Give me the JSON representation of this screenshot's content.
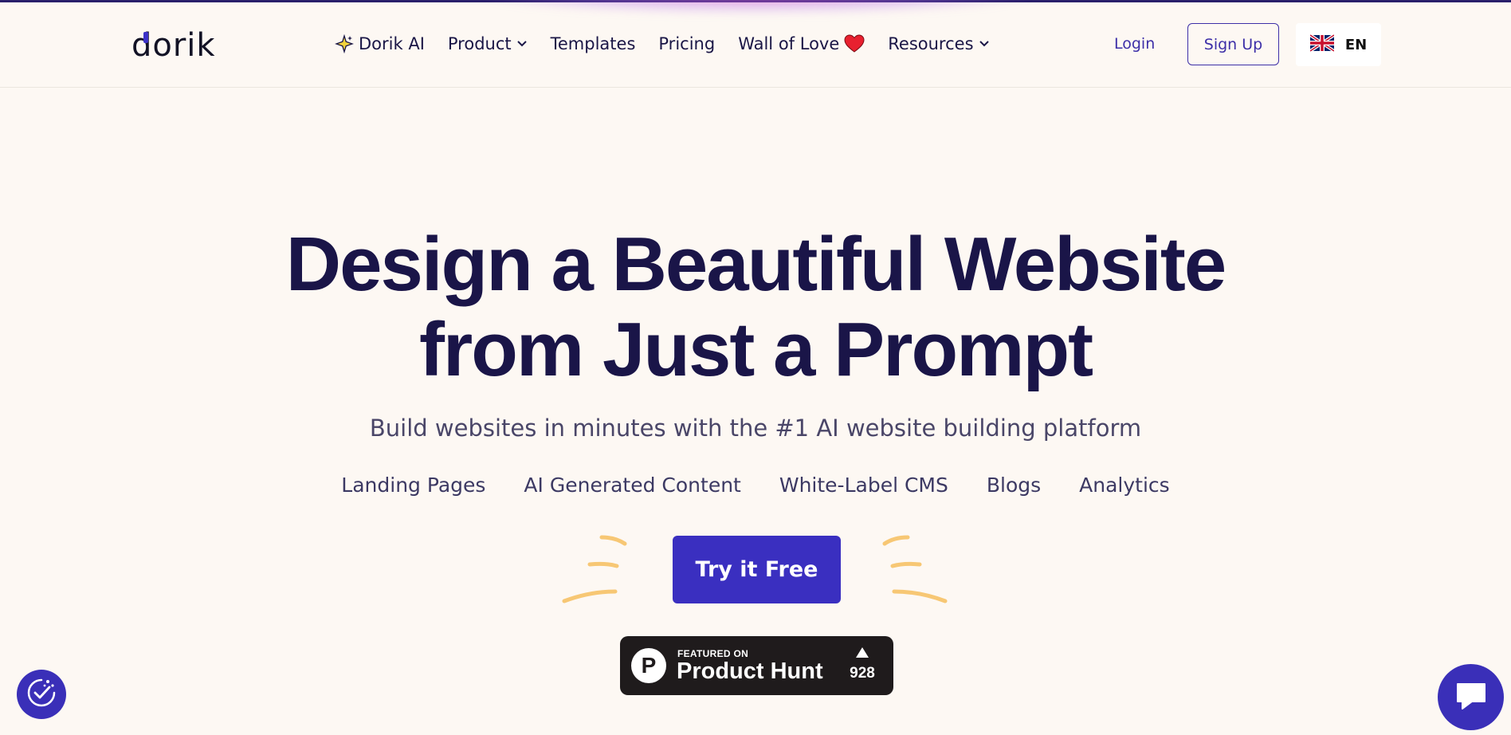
{
  "brand": {
    "logo_text": "dorik",
    "accent": "#3a2fc0",
    "text_color": "#1a1548",
    "background": "#fdf8f3"
  },
  "nav": {
    "items": [
      {
        "label": "Dorik AI",
        "icon": "sparkle-icon"
      },
      {
        "label": "Product",
        "icon": "chevron-down-icon"
      },
      {
        "label": "Templates"
      },
      {
        "label": "Pricing"
      },
      {
        "label": "Wall of Love",
        "icon": "heart-icon"
      },
      {
        "label": "Resources",
        "icon": "chevron-down-icon"
      }
    ],
    "login": "Login",
    "signup": "Sign Up",
    "language": {
      "code": "EN",
      "icon": "uk-flag-icon"
    }
  },
  "hero": {
    "title_line1": "Design a Beautiful Website",
    "title_line2": "from Just a Prompt",
    "subtitle": "Build websites in minutes with the #1 AI website building platform",
    "features": [
      "Landing Pages",
      "AI Generated Content",
      "White-Label CMS",
      "Blogs",
      "Analytics"
    ],
    "cta": "Try it Free"
  },
  "product_hunt": {
    "featured_text": "FEATURED ON",
    "name": "Product Hunt",
    "logo_letter": "P",
    "upvotes": "928"
  },
  "widgets": {
    "cookie_icon": "cookie-consent-icon",
    "chat_icon": "chat-bubble-icon"
  }
}
